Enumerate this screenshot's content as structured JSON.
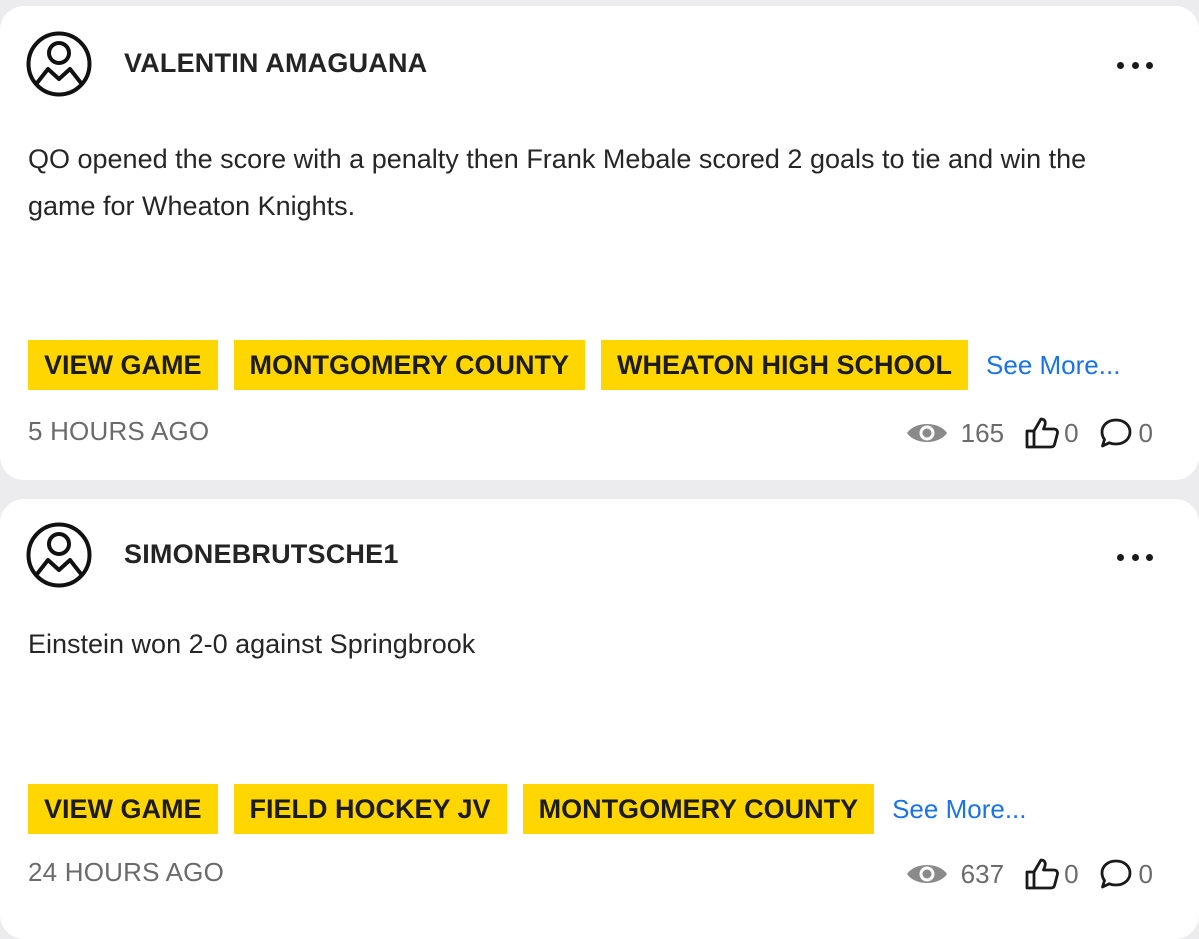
{
  "posts": [
    {
      "author": "VALENTIN AMAGUANA",
      "text": "QO opened the score with a penalty then Frank Mebale scored 2 goals to tie and win the game for Wheaton Knights.",
      "tags": [
        "VIEW GAME",
        "MONTGOMERY COUNTY",
        "WHEATON HIGH SCHOOL"
      ],
      "see_more": "See More...",
      "time": "5 HOURS AGO",
      "views": "165",
      "likes": "0",
      "comments": "0"
    },
    {
      "author": "SIMONEBRUTSCHE1",
      "text": "Einstein won 2-0 against Springbrook",
      "tags": [
        "VIEW GAME",
        "FIELD HOCKEY JV",
        "MONTGOMERY COUNTY"
      ],
      "see_more": "See More...",
      "time": "24 HOURS AGO",
      "views": "637",
      "likes": "0",
      "comments": "0"
    }
  ],
  "colors": {
    "tag_background": "#ffd600",
    "link": "#1a73e8",
    "muted_text": "#6b6b6b",
    "page_background": "#ececee",
    "card_background": "#ffffff"
  },
  "icons": {
    "avatar": "user-avatar-icon",
    "more": "more-options-icon",
    "views": "eye-icon",
    "likes": "thumbs-up-icon",
    "comments": "comment-bubble-icon"
  }
}
